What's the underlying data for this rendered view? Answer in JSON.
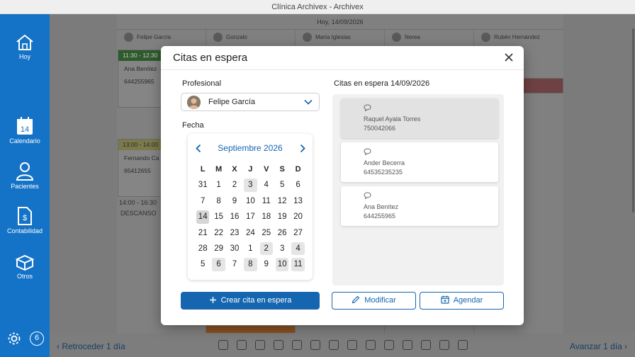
{
  "window": {
    "title": "Clínica Archivex - Archivex"
  },
  "sidebar": {
    "items": [
      {
        "label": "Hoy",
        "icon": "home-icon"
      },
      {
        "label": "Calendario",
        "icon": "calendar-icon",
        "day": "14"
      },
      {
        "label": "Pacientes",
        "icon": "person-icon"
      },
      {
        "label": "Contabilidad",
        "icon": "invoice-icon"
      },
      {
        "label": "Otros",
        "icon": "box-icon"
      }
    ],
    "badge": "6"
  },
  "background": {
    "date": "Hoy, 14/09/2026",
    "columns": [
      "Felipe García",
      "Gonzalo",
      "María Iglesias",
      "Nerea",
      "Rubén Hernández"
    ],
    "appointments": [
      {
        "time": "11:30 - 12:30",
        "name": "Ana Benítez",
        "phone": "644255965"
      },
      {
        "time": "13:00 - 14:00",
        "name": "Fernando Ca",
        "phone": "65412655"
      }
    ],
    "rest": {
      "time": "14:00 - 16:30",
      "label": "DESCANSO"
    },
    "prev_day": "Retroceder 1 día",
    "next_day": "Avanzar 1 día"
  },
  "modal": {
    "title": "Citas en espera",
    "professional_label": "Profesional",
    "professional": "Felipe García",
    "date_label": "Fecha",
    "calendar": {
      "month": "Septiembre 2026",
      "weekdays": [
        "L",
        "M",
        "X",
        "J",
        "V",
        "S",
        "D"
      ],
      "days": [
        [
          "31",
          "1",
          "2",
          "3",
          "4",
          "5",
          "6"
        ],
        [
          "7",
          "8",
          "9",
          "10",
          "11",
          "12",
          "13"
        ],
        [
          "14",
          "15",
          "16",
          "17",
          "18",
          "19",
          "20"
        ],
        [
          "21",
          "22",
          "23",
          "24",
          "25",
          "26",
          "27"
        ],
        [
          "28",
          "29",
          "30",
          "1",
          "2",
          "3",
          "4"
        ],
        [
          "5",
          "6",
          "7",
          "8",
          "9",
          "10",
          "11"
        ]
      ],
      "highlighted": [
        [
          0,
          3
        ],
        [
          2,
          0
        ],
        [
          4,
          4
        ],
        [
          4,
          6
        ],
        [
          5,
          1
        ],
        [
          5,
          3
        ],
        [
          5,
          5
        ],
        [
          5,
          6
        ]
      ],
      "selected": [
        2,
        0
      ]
    },
    "waitlist_title": "Citas en espera 14/09/2026",
    "waitlist": [
      {
        "name": "Raquel Ayala Torres",
        "phone": "750042066"
      },
      {
        "name": "Ander Becerra",
        "phone": "64535235235"
      },
      {
        "name": "Ana Benítez",
        "phone": "644255965"
      }
    ],
    "buttons": {
      "create": "Crear cita en espera",
      "modify": "Modificar",
      "schedule": "Agendar"
    }
  },
  "colors": {
    "primary": "#1565b0",
    "sidebar": "#1473c6"
  }
}
